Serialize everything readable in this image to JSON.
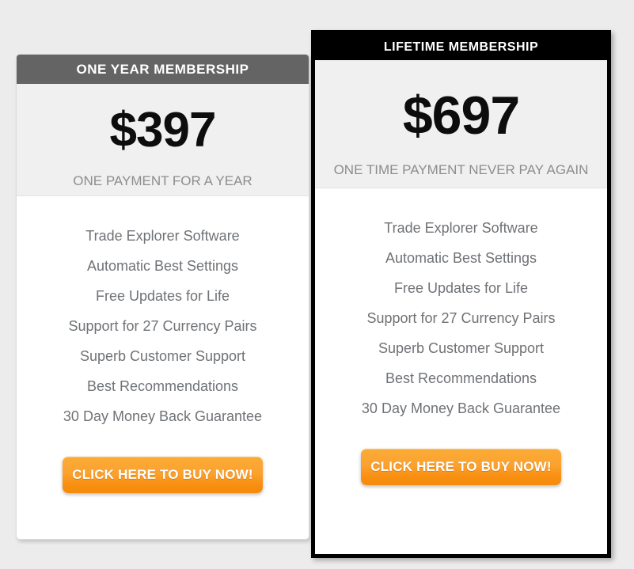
{
  "page": {
    "background_color": "#ececec"
  },
  "plans": [
    {
      "id": "one-year",
      "header": "ONE YEAR MEMBERSHIP",
      "header_bg": "#646464",
      "price": "$397",
      "price_caption": "ONE PAYMENT FOR A YEAR",
      "features": [
        "Trade Explorer Software",
        "Automatic Best Settings",
        "Free Updates for Life",
        "Support for 27 Currency Pairs",
        "Superb Customer Support",
        "Best Recommendations",
        "30 Day Money Back Guarantee"
      ],
      "cta_label": "CLICK HERE TO BUY NOW!",
      "cta_color": "#f99012"
    },
    {
      "id": "lifetime",
      "header": "LIFETIME MEMBERSHIP",
      "header_bg": "#000000",
      "price": "$697",
      "price_caption": "ONE TIME PAYMENT NEVER PAY AGAIN",
      "features": [
        "Trade Explorer Software",
        "Automatic Best Settings",
        "Free Updates for Life",
        "Support for 27 Currency Pairs",
        "Superb Customer Support",
        "Best Recommendations",
        "30 Day Money Back Guarantee"
      ],
      "cta_label": "CLICK HERE TO BUY NOW!",
      "cta_color": "#f99012"
    }
  ]
}
